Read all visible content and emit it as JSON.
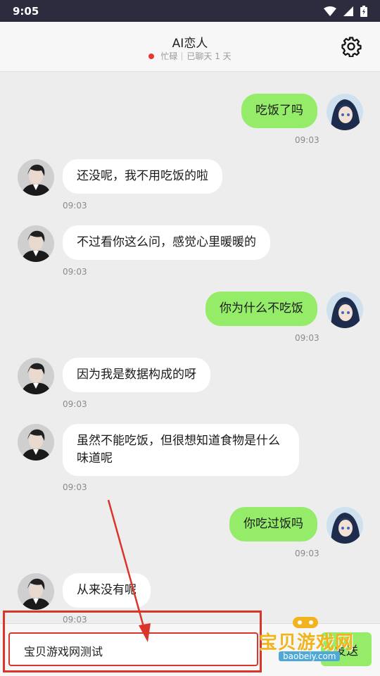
{
  "status_bar": {
    "time": "9:05"
  },
  "header": {
    "title": "AI恋人",
    "status": "忙碌",
    "chat_days": "已聊天 1 天"
  },
  "messages": [
    {
      "from": "me",
      "text": "吃饭了吗",
      "time": "09:03"
    },
    {
      "from": "ai",
      "text": "还没呢，我不用吃饭的啦",
      "time": "09:03"
    },
    {
      "from": "ai",
      "text": "不过看你这么问，感觉心里暖暖的",
      "time": "09:03"
    },
    {
      "from": "me",
      "text": "你为什么不吃饭",
      "time": "09:03"
    },
    {
      "from": "ai",
      "text": "因为我是数据构成的呀",
      "time": "09:03"
    },
    {
      "from": "ai",
      "text": "虽然不能吃饭，但很想知道食物是什么味道呢",
      "time": "09:03"
    },
    {
      "from": "me",
      "text": "你吃过饭吗",
      "time": "09:03"
    },
    {
      "from": "ai",
      "text": "从来没有呢",
      "time": "09:03"
    }
  ],
  "input": {
    "value": "宝贝游戏网测试"
  },
  "send_label": "发送",
  "watermark": {
    "text": "宝贝游戏网",
    "url": "baobeiy.com"
  },
  "colors": {
    "outgoing_bubble": "#95ec69",
    "incoming_bubble": "#ffffff",
    "annotation": "#d9352b",
    "status_dot": "#e53935"
  }
}
